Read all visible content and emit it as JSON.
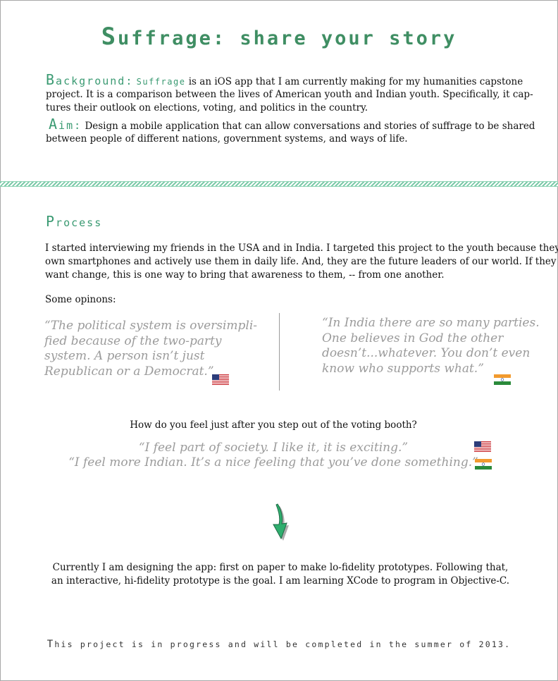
{
  "title": {
    "first": "S",
    "rest": "uffrage: share your story"
  },
  "background": {
    "label_first": "B",
    "label_rest": "ackground:",
    "app_name": "Suffrage",
    "text_line1": " is an iOS app that I am currently making for my humanities capstone",
    "text_line2": "project.  It is a comparison between the lives of American youth and Indian youth.  Specifically, it cap-",
    "text_line3": "tures their outlook on elections, voting, and politics in the country."
  },
  "aim": {
    "label_first": "A",
    "label_rest": "im:",
    "text_line1": "Design a mobile application that can allow conversations and stories of suffrage to be shared",
    "text_line2": "between people of different nations, government systems, and ways of life."
  },
  "process": {
    "heading_first": "P",
    "heading_rest": "rocess",
    "line1": "I started interviewing my friends in the USA and in India.  I targeted this project to the youth because they",
    "line2": "own smartphones and actively use them in daily life.  And, they are the future leaders of our world.  If they",
    "line3": "want change, this is one way to bring that awareness to them, -- from one another.",
    "opinions_label": "Some opinons:"
  },
  "quote_us": {
    "l1": "“The political system is oversimpli-",
    "l2": "fied because of the two-party",
    "l3": "system.  A person isn’t just",
    "l4": "Republican or a Democrat.”"
  },
  "quote_in": {
    "l1": "“In India there are so many parties.",
    "l2": "One believes in God the other",
    "l3": "doesn’t...whatever.  You don’t even",
    "l4": "know who supports what.”"
  },
  "voting": {
    "question": "How do you feel just after you step out of the voting booth?",
    "answer_us": "“I feel part of society.  I like it, it is exciting.”",
    "answer_in": "“I feel more Indian.  It’s a nice feeling that you’ve done something.”"
  },
  "current": {
    "line1": "Currently I am designing the app: first on paper to make lo-fidelity prototypes.  Following that,",
    "line2": "an interactive, hi-fidelity prototype is the goal.  I am learning XCode to program in Objective-C."
  },
  "footer": {
    "first": "T",
    "rest": "his project is in progress and will be completed in the summer of 2013."
  },
  "colors": {
    "accent": "#3a9a72",
    "quote": "#9b9b9b",
    "divider": "#7ccaa9"
  },
  "icons": {
    "us_flag": "us-flag-icon",
    "india_flag": "india-flag-icon",
    "arrow": "arrow-down-icon"
  }
}
